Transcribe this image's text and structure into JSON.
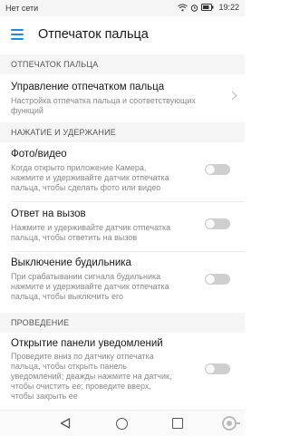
{
  "status_bar": {
    "carrier": "Нет сети",
    "time": "19:22"
  },
  "app_bar": {
    "title": "Отпечаток пальца"
  },
  "sections": [
    {
      "header": "ОТПЕЧАТОК ПАЛЬЦА"
    },
    {
      "header": "НАЖАТИЕ И УДЕРЖАНИЕ"
    },
    {
      "header": "ПРОВЕДЕНИЕ"
    }
  ],
  "items": [
    {
      "title": "Управление отпечатком пальца",
      "subtitle": [
        "Настройка отпечатка пальца и соответствующих",
        "функций"
      ]
    },
    {
      "title": "Фото/видео",
      "subtitle": [
        "Когда открыто приложение Камера,",
        "нажмите и удерживайте датчик отпечатка",
        "пальца, чтобы сделать фото или видео"
      ],
      "enabled": false
    },
    {
      "title": "Ответ на вызов",
      "subtitle": [
        "Нажмите и удерживайте датчик отпечатка",
        "пальца, чтобы ответить на вызов"
      ],
      "enabled": false
    },
    {
      "title": "Выключение будильника",
      "subtitle": [
        "При срабатывании сигнала будильника",
        "нажмите и удерживайте датчик отпечатка",
        "пальца, чтобы выключить его"
      ],
      "enabled": false
    },
    {
      "title": "Открытие панели уведомлений",
      "subtitle": [
        "Проведите вниз по датчику отпечатка",
        "пальца, чтобы открыть панель",
        "уведомлений; дважды нажмите на датчик,",
        "чтобы очистить ее; проведите вверх,",
        "чтобы закрыть ее"
      ],
      "enabled": false
    }
  ],
  "colors": {
    "accent": "#1e88e5",
    "toggle_off": "#cfcfcf",
    "section_bg": "#f5f5f5"
  }
}
